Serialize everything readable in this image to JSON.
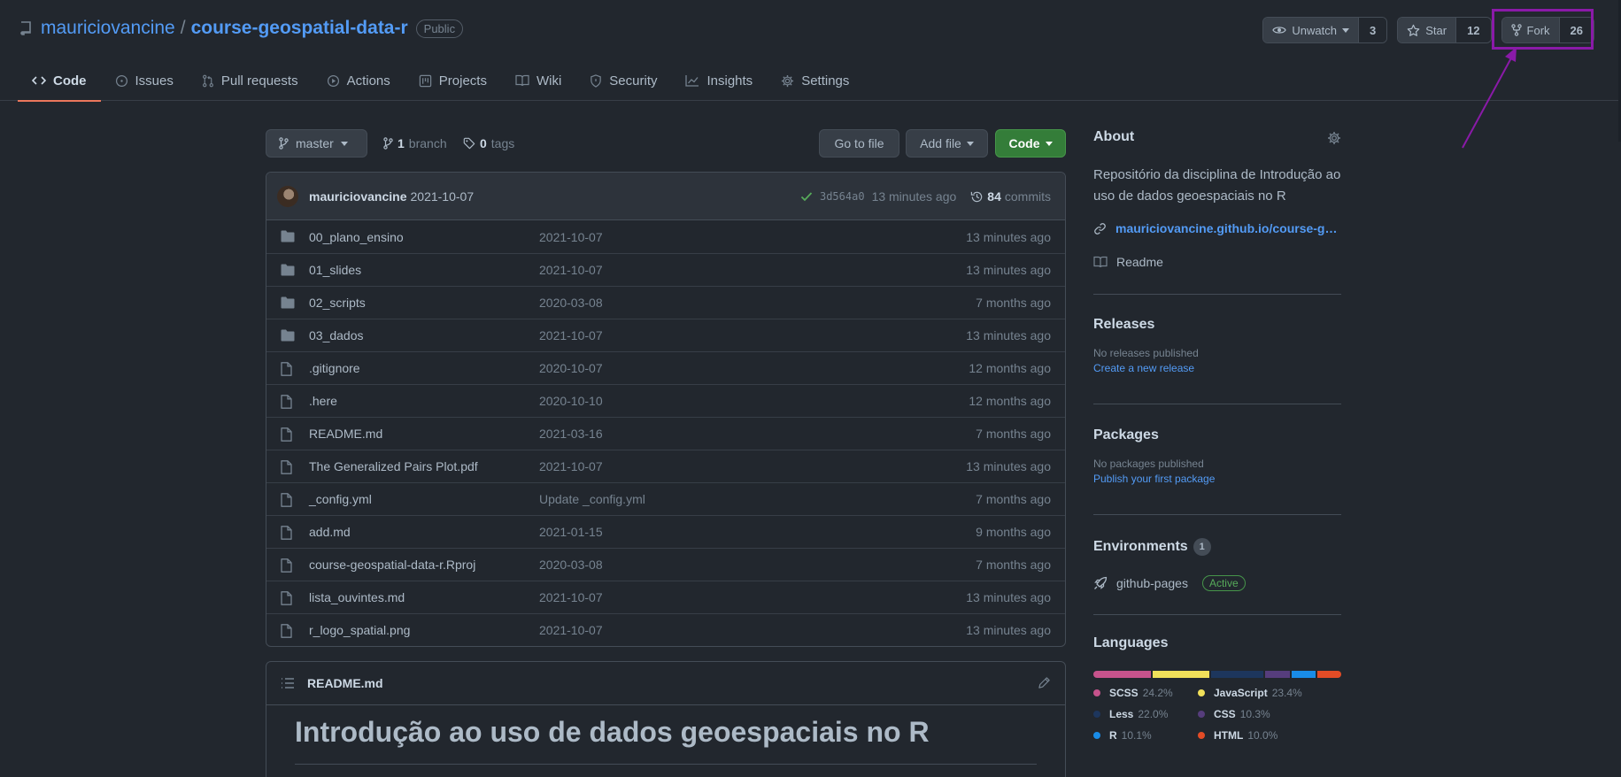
{
  "header": {
    "owner": "mauriciovancine",
    "separator": "/",
    "repo": "course-geospatial-data-r",
    "visibility": "Public",
    "watch": {
      "label": "Unwatch",
      "count": "3"
    },
    "star": {
      "label": "Star",
      "count": "12"
    },
    "fork": {
      "label": "Fork",
      "count": "26"
    }
  },
  "tabs": [
    {
      "label": "Code",
      "icon": "code-icon",
      "active": true
    },
    {
      "label": "Issues",
      "icon": "issue-icon"
    },
    {
      "label": "Pull requests",
      "icon": "pull-request-icon"
    },
    {
      "label": "Actions",
      "icon": "play-icon"
    },
    {
      "label": "Projects",
      "icon": "project-icon"
    },
    {
      "label": "Wiki",
      "icon": "book-icon"
    },
    {
      "label": "Security",
      "icon": "shield-icon"
    },
    {
      "label": "Insights",
      "icon": "graph-icon"
    },
    {
      "label": "Settings",
      "icon": "gear-icon"
    }
  ],
  "filebar": {
    "branch": "master",
    "branches_count": "1",
    "branches_label": "branch",
    "tags_count": "0",
    "tags_label": "tags",
    "go_to_file": "Go to file",
    "add_file": "Add file",
    "code": "Code"
  },
  "commit": {
    "author": "mauriciovancine",
    "message": "2021-10-07",
    "sha": "3d564a0",
    "age": "13 minutes ago",
    "commits_count": "84",
    "commits_label": "commits"
  },
  "files": [
    {
      "type": "dir",
      "name": "00_plano_ensino",
      "message": "2021-10-07",
      "age": "13 minutes ago"
    },
    {
      "type": "dir",
      "name": "01_slides",
      "message": "2021-10-07",
      "age": "13 minutes ago"
    },
    {
      "type": "dir",
      "name": "02_scripts",
      "message": "2020-03-08",
      "age": "7 months ago"
    },
    {
      "type": "dir",
      "name": "03_dados",
      "message": "2021-10-07",
      "age": "13 minutes ago"
    },
    {
      "type": "file",
      "name": ".gitignore",
      "message": "2020-10-07",
      "age": "12 months ago"
    },
    {
      "type": "file",
      "name": ".here",
      "message": "2020-10-10",
      "age": "12 months ago"
    },
    {
      "type": "file",
      "name": "README.md",
      "message": "2021-03-16",
      "age": "7 months ago"
    },
    {
      "type": "file",
      "name": "The Generalized Pairs Plot.pdf",
      "message": "2021-10-07",
      "age": "13 minutes ago"
    },
    {
      "type": "file",
      "name": "_config.yml",
      "message": "Update _config.yml",
      "age": "7 months ago"
    },
    {
      "type": "file",
      "name": "add.md",
      "message": "2021-01-15",
      "age": "9 months ago"
    },
    {
      "type": "file",
      "name": "course-geospatial-data-r.Rproj",
      "message": "2020-03-08",
      "age": "7 months ago"
    },
    {
      "type": "file",
      "name": "lista_ouvintes.md",
      "message": "2021-10-07",
      "age": "13 minutes ago"
    },
    {
      "type": "file",
      "name": "r_logo_spatial.png",
      "message": "2021-10-07",
      "age": "13 minutes ago"
    }
  ],
  "readme": {
    "filename": "README.md",
    "heading": "Introdução ao uso de dados geoespaciais no R"
  },
  "sidebar": {
    "about": {
      "title": "About",
      "description": "Repositório da disciplina de Introdução ao uso de dados geoespaciais no R",
      "url": "mauriciovancine.github.io/course-g…",
      "readme": "Readme"
    },
    "releases": {
      "title": "Releases",
      "note": "No releases published",
      "link": "Create a new release"
    },
    "packages": {
      "title": "Packages",
      "note": "No packages published",
      "link": "Publish your first package"
    },
    "environments": {
      "title": "Environments",
      "count": "1",
      "name": "github-pages",
      "status": "Active"
    },
    "languages": {
      "title": "Languages",
      "items": [
        {
          "name": "SCSS",
          "percent": "24.2%",
          "value": 24.2,
          "color": "#c6538c"
        },
        {
          "name": "JavaScript",
          "percent": "23.4%",
          "value": 23.4,
          "color": "#f1e05a"
        },
        {
          "name": "Less",
          "percent": "22.0%",
          "value": 22.0,
          "color": "#1d365d"
        },
        {
          "name": "CSS",
          "percent": "10.3%",
          "value": 10.3,
          "color": "#563d7c"
        },
        {
          "name": "R",
          "percent": "10.1%",
          "value": 10.1,
          "color": "#198ce7"
        },
        {
          "name": "HTML",
          "percent": "10.0%",
          "value": 10.0,
          "color": "#e34c26"
        }
      ]
    }
  },
  "colors": {
    "background": "#22272e",
    "accent_link": "#539bf5",
    "active_tab_underline": "#ec775c",
    "code_button": "#347d39",
    "annotation": "#8a1aa8"
  }
}
